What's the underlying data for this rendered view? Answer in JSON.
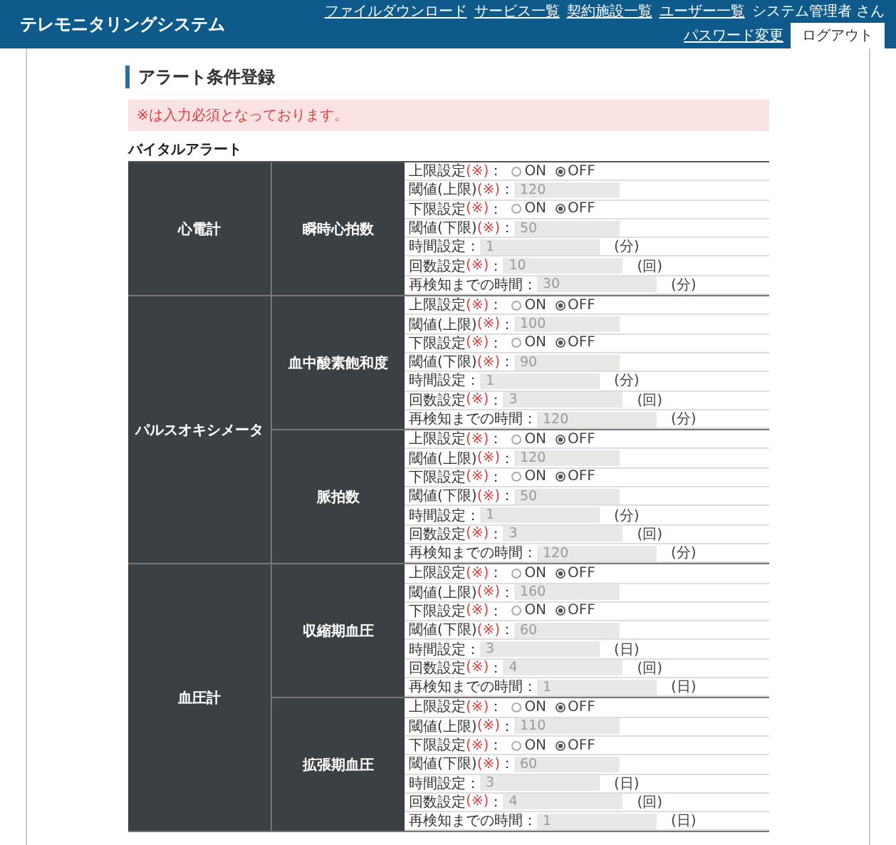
{
  "header": {
    "title": "テレモニタリングシステム",
    "links": [
      "ファイルダウンロード",
      "サービス一覧",
      "契約施設一覧",
      "ユーザー一覧"
    ],
    "user": "システム管理者 さん",
    "password_link": "パスワード変更",
    "logout": "ログアウト"
  },
  "page_title": "アラート条件登録",
  "notice": "※は入力必須となっております。",
  "section_title": "バイタルアラート",
  "groups": [
    {
      "device": "心電計",
      "items": [
        {
          "name": "瞬時心拍数",
          "rows": [
            {
              "kind": "radio",
              "label": "上限設定",
              "req": "(※)",
              "colon": "：",
              "options": [
                {
                  "label": "ON",
                  "selected": false
                },
                {
                  "label": "OFF",
                  "selected": true
                }
              ]
            },
            {
              "kind": "input",
              "label": "閾値(上限)",
              "req": "(※)",
              "colon": "：",
              "value": "120"
            },
            {
              "kind": "radio",
              "label": "下限設定",
              "req": "(※)",
              "colon": "：",
              "options": [
                {
                  "label": "ON",
                  "selected": false
                },
                {
                  "label": "OFF",
                  "selected": true
                }
              ]
            },
            {
              "kind": "input",
              "label": "閾値(下限)",
              "req": "(※)",
              "colon": "：",
              "value": "50"
            },
            {
              "kind": "input",
              "label": "時間設定：",
              "value": "1",
              "unit": "(分)"
            },
            {
              "kind": "input",
              "label": "回数設定",
              "req": "(※)",
              "colon": "：",
              "value": "10",
              "unit": "(回)"
            },
            {
              "kind": "input",
              "label": "再検知までの時間：",
              "value": "30",
              "unit": "(分)"
            }
          ]
        }
      ]
    },
    {
      "device": "パルスオキシメータ",
      "items": [
        {
          "name": "血中酸素飽和度",
          "rows": [
            {
              "kind": "radio",
              "label": "上限設定",
              "req": "(※)",
              "colon": "：",
              "options": [
                {
                  "label": "ON",
                  "selected": false
                },
                {
                  "label": "OFF",
                  "selected": true
                }
              ]
            },
            {
              "kind": "input",
              "label": "閾値(上限)",
              "req": "(※)",
              "colon": "：",
              "value": "100"
            },
            {
              "kind": "radio",
              "label": "下限設定",
              "req": "(※)",
              "colon": "：",
              "options": [
                {
                  "label": "ON",
                  "selected": false
                },
                {
                  "label": "OFF",
                  "selected": true
                }
              ]
            },
            {
              "kind": "input",
              "label": "閾値(下限)",
              "req": "(※)",
              "colon": "：",
              "value": "90"
            },
            {
              "kind": "input",
              "label": "時間設定：",
              "value": "1",
              "unit": "(分)"
            },
            {
              "kind": "input",
              "label": "回数設定",
              "req": "(※)",
              "colon": "：",
              "value": "3",
              "unit": "(回)"
            },
            {
              "kind": "input",
              "label": "再検知までの時間：",
              "value": "120",
              "unit": "(分)"
            }
          ]
        },
        {
          "name": "脈拍数",
          "rows": [
            {
              "kind": "radio",
              "label": "上限設定",
              "req": "(※)",
              "colon": "：",
              "options": [
                {
                  "label": "ON",
                  "selected": false
                },
                {
                  "label": "OFF",
                  "selected": true
                }
              ]
            },
            {
              "kind": "input",
              "label": "閾値(上限)",
              "req": "(※)",
              "colon": "：",
              "value": "120"
            },
            {
              "kind": "radio",
              "label": "下限設定",
              "req": "(※)",
              "colon": "：",
              "options": [
                {
                  "label": "ON",
                  "selected": false
                },
                {
                  "label": "OFF",
                  "selected": true
                }
              ]
            },
            {
              "kind": "input",
              "label": "閾値(下限)",
              "req": "(※)",
              "colon": "：",
              "value": "50"
            },
            {
              "kind": "input",
              "label": "時間設定：",
              "value": "1",
              "unit": "(分)"
            },
            {
              "kind": "input",
              "label": "回数設定",
              "req": "(※)",
              "colon": "：",
              "value": "3",
              "unit": "(回)"
            },
            {
              "kind": "input",
              "label": "再検知までの時間：",
              "value": "120",
              "unit": "(分)"
            }
          ]
        }
      ]
    },
    {
      "device": "血圧計",
      "items": [
        {
          "name": "収縮期血圧",
          "rows": [
            {
              "kind": "radio",
              "label": "上限設定",
              "req": "(※)",
              "colon": "：",
              "options": [
                {
                  "label": "ON",
                  "selected": false
                },
                {
                  "label": "OFF",
                  "selected": true
                }
              ]
            },
            {
              "kind": "input",
              "label": "閾値(上限)",
              "req": "(※)",
              "colon": "：",
              "value": "160"
            },
            {
              "kind": "radio",
              "label": "下限設定",
              "req": "(※)",
              "colon": "：",
              "options": [
                {
                  "label": "ON",
                  "selected": false
                },
                {
                  "label": "OFF",
                  "selected": true
                }
              ]
            },
            {
              "kind": "input",
              "label": "閾値(下限)",
              "req": "(※)",
              "colon": "：",
              "value": "60"
            },
            {
              "kind": "input",
              "label": "時間設定：",
              "value": "3",
              "unit": "(日)"
            },
            {
              "kind": "input",
              "label": "回数設定",
              "req": "(※)",
              "colon": "：",
              "value": "4",
              "unit": "(回)"
            },
            {
              "kind": "input",
              "label": "再検知までの時間：",
              "value": "1",
              "unit": "(日)"
            }
          ]
        },
        {
          "name": "拡張期血圧",
          "rows": [
            {
              "kind": "radio",
              "label": "上限設定",
              "req": "(※)",
              "colon": "：",
              "options": [
                {
                  "label": "ON",
                  "selected": false
                },
                {
                  "label": "OFF",
                  "selected": true
                }
              ]
            },
            {
              "kind": "input",
              "label": "閾値(上限)",
              "req": "(※)",
              "colon": "：",
              "value": "110"
            },
            {
              "kind": "radio",
              "label": "下限設定",
              "req": "(※)",
              "colon": "：",
              "options": [
                {
                  "label": "ON",
                  "selected": false
                },
                {
                  "label": "OFF",
                  "selected": true
                }
              ]
            },
            {
              "kind": "input",
              "label": "閾値(下限)",
              "req": "(※)",
              "colon": "：",
              "value": "60"
            },
            {
              "kind": "input",
              "label": "時間設定：",
              "value": "3",
              "unit": "(日)"
            },
            {
              "kind": "input",
              "label": "回数設定",
              "req": "(※)",
              "colon": "：",
              "value": "4",
              "unit": "(回)"
            },
            {
              "kind": "input",
              "label": "再検知までの時間：",
              "value": "1",
              "unit": "(日)"
            }
          ]
        }
      ]
    }
  ]
}
